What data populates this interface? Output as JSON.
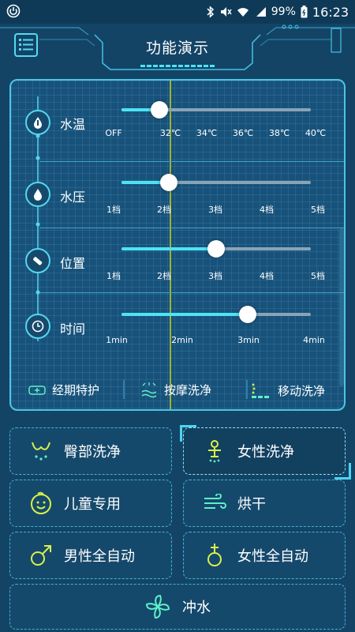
{
  "status_bar": {
    "battery": "99%",
    "time": "16:23"
  },
  "header": {
    "title": "功能演示"
  },
  "panel": {
    "rows": [
      {
        "label": "水温",
        "icon": "water-temperature-icon",
        "ticks": [
          "OFF",
          "32℃",
          "34℃",
          "36℃",
          "38℃",
          "40℃"
        ],
        "value_fraction": 0.2
      },
      {
        "label": "水压",
        "icon": "water-drop-icon",
        "ticks": [
          "1档",
          "2档",
          "3档",
          "4档",
          "5档"
        ],
        "value_fraction": 0.25
      },
      {
        "label": "位置",
        "icon": "nozzle-icon",
        "ticks": [
          "1档",
          "2档",
          "3档",
          "4档",
          "5档"
        ],
        "value_fraction": 0.5
      },
      {
        "label": "时间",
        "icon": "clock-icon",
        "ticks": [
          "1min",
          "2min",
          "3min",
          "4min"
        ],
        "value_fraction": 0.667
      }
    ],
    "bottom_items": [
      {
        "label": "经期特护",
        "icon": "period-care-icon"
      },
      {
        "label": "按摩洗净",
        "icon": "massage-wash-icon"
      },
      {
        "label": "移动洗净",
        "icon": "moving-wash-icon"
      }
    ]
  },
  "modes": [
    {
      "label": "臀部洗净",
      "icon": "hip-wash-icon",
      "active": false
    },
    {
      "label": "女性洗净",
      "icon": "female-wash-icon",
      "active": true
    },
    {
      "label": "儿童专用",
      "icon": "child-face-icon",
      "active": false
    },
    {
      "label": "烘干",
      "icon": "wind-dry-icon",
      "active": false
    },
    {
      "label": "男性全自动",
      "icon": "male-symbol-icon",
      "active": false
    },
    {
      "label": "女性全自动",
      "icon": "female-symbol-icon",
      "active": false
    },
    {
      "label": "冲水",
      "icon": "flush-fan-icon",
      "active": false
    }
  ],
  "colors": {
    "accent": "#4de3f5",
    "background": "#134466",
    "marker_line": "#b7c227"
  }
}
